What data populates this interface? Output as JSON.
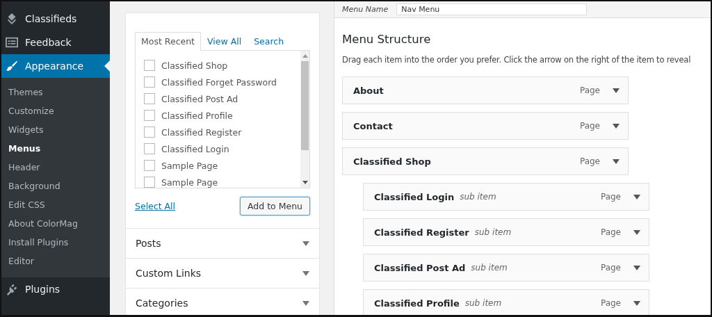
{
  "sidebar": {
    "items": [
      {
        "label": "Classifieds",
        "kind": "stack",
        "selected": false
      },
      {
        "label": "Feedback",
        "kind": "form",
        "selected": false
      },
      {
        "label": "Appearance",
        "kind": "brush",
        "selected": true,
        "children": [
          {
            "label": "Themes",
            "selected": false
          },
          {
            "label": "Customize",
            "selected": false
          },
          {
            "label": "Widgets",
            "selected": false
          },
          {
            "label": "Menus",
            "selected": true
          },
          {
            "label": "Header",
            "selected": false
          },
          {
            "label": "Background",
            "selected": false
          },
          {
            "label": "Edit CSS",
            "selected": false
          },
          {
            "label": "About ColorMag",
            "selected": false
          },
          {
            "label": "Install Plugins",
            "selected": false
          },
          {
            "label": "Editor",
            "selected": false
          }
        ]
      },
      {
        "label": "Plugins",
        "kind": "plug",
        "selected": false
      }
    ]
  },
  "pages_box": {
    "tabs": [
      {
        "label": "Most Recent",
        "selected": true
      },
      {
        "label": "View All",
        "selected": false
      },
      {
        "label": "Search",
        "selected": false
      }
    ],
    "items": [
      {
        "label": "Classified Shop",
        "checked": false
      },
      {
        "label": "Classified Forget Password",
        "checked": false
      },
      {
        "label": "Classified Post Ad",
        "checked": false
      },
      {
        "label": "Classified Profile",
        "checked": false
      },
      {
        "label": "Classified Register",
        "checked": false
      },
      {
        "label": "Classified Login",
        "checked": false
      },
      {
        "label": "Sample Page",
        "checked": false
      },
      {
        "label": "Sample Page",
        "checked": false
      }
    ],
    "select_all": "Select All",
    "add_button": "Add to Menu"
  },
  "sections": [
    {
      "title": "Posts",
      "expanded": false
    },
    {
      "title": "Custom Links",
      "expanded": false
    },
    {
      "title": "Categories",
      "expanded": false
    }
  ],
  "menu_name": {
    "label": "Menu Name",
    "value": "Nav Menu"
  },
  "menu_structure": {
    "title": "Menu Structure",
    "hint": "Drag each item into the order you prefer. Click the arrow on the right of the item to reveal",
    "items": [
      {
        "title": "About",
        "type": "Page"
      },
      {
        "title": "Contact",
        "type": "Page"
      },
      {
        "title": "Classified Shop",
        "type": "Page",
        "children": [
          {
            "title": "Classified Login",
            "note": "sub item",
            "type": "Page"
          },
          {
            "title": "Classified Register",
            "note": "sub item",
            "type": "Page"
          },
          {
            "title": "Classified Post Ad",
            "note": "sub item",
            "type": "Page"
          },
          {
            "title": "Classified Profile",
            "note": "sub item",
            "type": "Page"
          }
        ]
      }
    ]
  }
}
